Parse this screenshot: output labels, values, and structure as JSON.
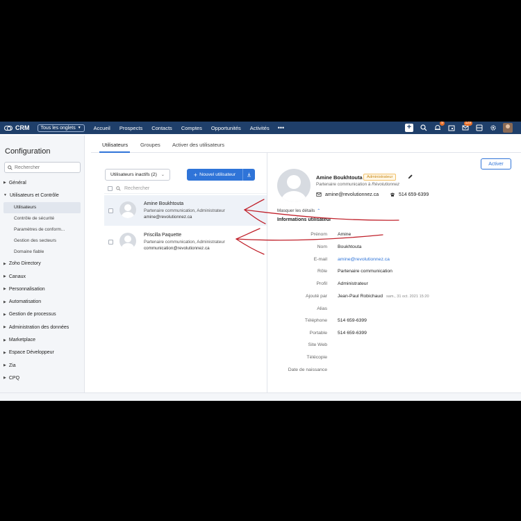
{
  "topbar": {
    "brand": "CRM",
    "all_tabs_label": "Tous les onglets",
    "nav_items": [
      "Accueil",
      "Prospects",
      "Contacts",
      "Comptes",
      "Opportunités",
      "Activités"
    ],
    "more_label": "•••",
    "notif_badge": "5",
    "mail_badge": "129"
  },
  "sidebar": {
    "title": "Configuration",
    "search_placeholder": "Rechercher",
    "sections": [
      {
        "label": "Général",
        "expanded": false
      },
      {
        "label": "Utilisateurs et Contrôle",
        "expanded": true,
        "children": [
          "Utilisateurs",
          "Contrôle de sécurité",
          "Paramètres de conform...",
          "Gestion des secteurs",
          "Domaine fiable"
        ],
        "active_child": "Utilisateurs"
      },
      {
        "label": "Zoho Directory",
        "expanded": false
      },
      {
        "label": "Canaux",
        "expanded": false
      },
      {
        "label": "Personnalisation",
        "expanded": false
      },
      {
        "label": "Automatisation",
        "expanded": false
      },
      {
        "label": "Gestion de processus",
        "expanded": false
      },
      {
        "label": "Administration des données",
        "expanded": false
      },
      {
        "label": "Marketplace",
        "expanded": false
      },
      {
        "label": "Espace Développeur",
        "expanded": false
      },
      {
        "label": "Zia",
        "expanded": false
      },
      {
        "label": "CPQ",
        "expanded": false
      }
    ]
  },
  "main": {
    "tabs": [
      "Utilisateurs",
      "Groupes",
      "Activer des utilisateurs"
    ],
    "active_tab": "Utilisateurs",
    "filter_label": "Utilisateurs inactifs (2)",
    "new_user_label": "Nouvel utilisateur",
    "list_search_placeholder": "Rechercher",
    "users": [
      {
        "name": "Amine Boukhtouta",
        "role": "Partenaire communication, Administrateur",
        "email": "amine@revolutionnez.ca",
        "selected": true
      },
      {
        "name": "Priscilla Paquette",
        "role": "Partenaire communication, Administrateur",
        "email": "communication@revolutionnez.ca",
        "selected": false
      }
    ]
  },
  "detail": {
    "activate_label": "Activer",
    "name": "Amine Boukhtouta",
    "badge": "Administrateur",
    "subtitle_prefix": "Partenaire communication à",
    "subtitle_org": "Révolutionnez",
    "email": "amine@revolutionnez.ca",
    "phone": "514 659-6399",
    "hide_details_label": "Masquer les détails",
    "section_title": "Informations utilisateur",
    "fields": [
      {
        "label": "Prénom",
        "value": "Amine"
      },
      {
        "label": "Nom",
        "value": "Boukhtouta"
      },
      {
        "label": "E-mail",
        "value": "amine@revolutionnez.ca"
      },
      {
        "label": "Rôle",
        "value": "Partenaire communication"
      },
      {
        "label": "Profil",
        "value": "Administrateur"
      },
      {
        "label": "Ajouté par",
        "value": "Jean-Paul Robichaud",
        "meta": "sam., 31 oct. 2021 15:20"
      },
      {
        "label": "Alias",
        "value": ""
      },
      {
        "label": "Téléphone",
        "value": "514 659-6399"
      },
      {
        "label": "Portable",
        "value": "514 659-6399"
      },
      {
        "label": "Site Web",
        "value": ""
      },
      {
        "label": "Télécopie",
        "value": ""
      },
      {
        "label": "Date de naissance",
        "value": ""
      }
    ]
  },
  "colors": {
    "topbar_bg": "#1f3f6a",
    "accent": "#2f74d8",
    "badge_border": "#f2c16b",
    "annotation_red": "#c0202a"
  },
  "icons": {
    "brand": "crm-logo-icon",
    "search": "search-icon",
    "notif": "bell-icon",
    "settings": "gear-icon",
    "mail": "mail-icon",
    "phone": "phone-icon",
    "edit": "pencil-icon",
    "download": "download-icon"
  }
}
